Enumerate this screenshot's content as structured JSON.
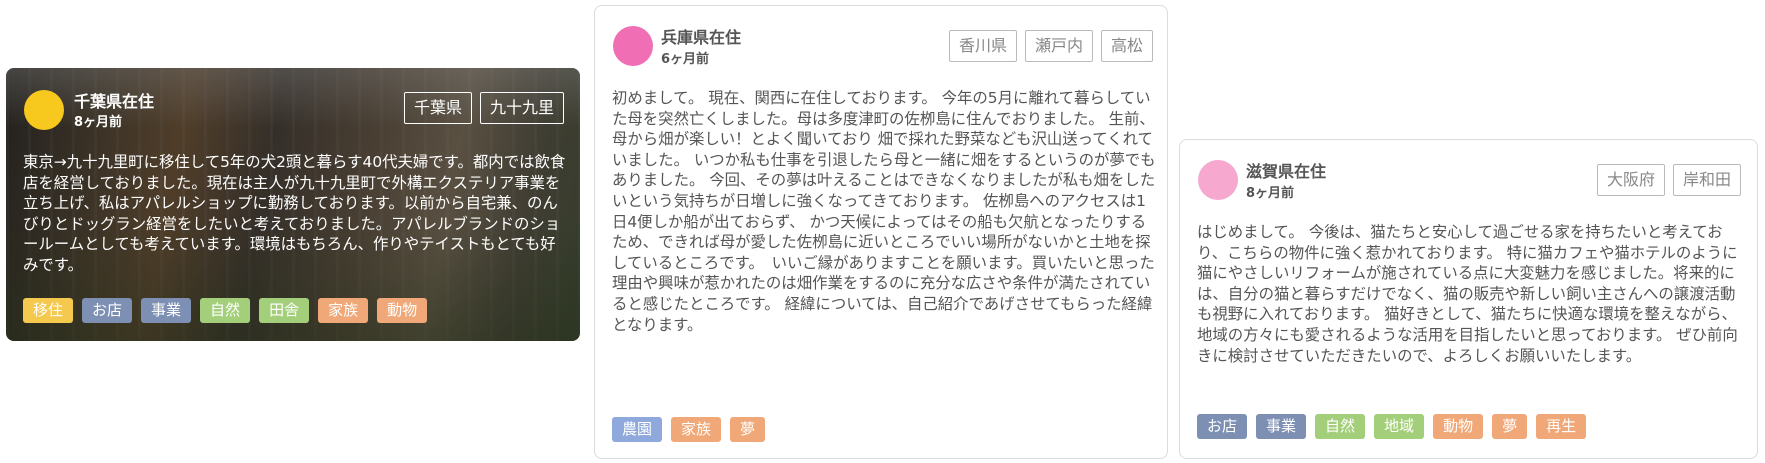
{
  "cards": [
    {
      "avatar_color": "#f7c81e",
      "location": "千葉県在住",
      "time_ago": "8ヶ月前",
      "places": [
        "千葉県",
        "九十九里"
      ],
      "text": "東京→九十九里町に移住して5年の犬2頭と暮らす40代夫婦です。都内では飲食店を経営しておりました。現在は主人が九十九里町で外構エクステリア事業を立ち上げ、私はアパレルショップに勤務しております。以前から自宅兼、のんびりとドッグラン経営をしたいと考えておりました。アパレルブランドのショールームとしても考えています。環境はもちろん、作りやテイストもとても好みです。",
      "tags": [
        {
          "label": "移住",
          "color": "#f5c84e"
        },
        {
          "label": "お店",
          "color": "#7d8fb3"
        },
        {
          "label": "事業",
          "color": "#7d8fb3"
        },
        {
          "label": "自然",
          "color": "#a3cf7a"
        },
        {
          "label": "田舎",
          "color": "#a3cf7a"
        },
        {
          "label": "家族",
          "color": "#f1a878"
        },
        {
          "label": "動物",
          "color": "#f1a878"
        }
      ]
    },
    {
      "avatar_color": "#f06fb4",
      "location": "兵庫県在住",
      "time_ago": "6ヶ月前",
      "places": [
        "香川県",
        "瀬戸内",
        "高松"
      ],
      "text": "初めまして。 現在、関西に在住しております。 今年の5月に離れて暮らしていた母を突然亡くしました。母は多度津町の佐栁島に住んでおりました。 生前、母から畑が楽しい！とよく聞いており 畑で採れた野菜なども沢山送ってくれていました。 いつか私も仕事を引退したら母と一緒に畑をするというのが夢でもありました。 今回、その夢は叶えることはできなくなりましたが私も畑をしたいという気持ちが日増しに強くなってきております。 佐栁島へのアクセスは1日4便しか船が出ておらず、 かつ天候によってはその船も欠航となったりするため、できれば母が愛した佐栁島に近いところでいい場所がないかと土地を探しているところです。　いいご縁がありますことを願います。買いたいと思った理由や興味が惹かれたのは畑作業をするのに充分な広さや条件が満たされていると感じたところです。 経緯については、自己紹介であげさせてもらった経緯となります。",
      "tags": [
        {
          "label": "農園",
          "color": "#8fa9dc"
        },
        {
          "label": "家族",
          "color": "#f1a878"
        },
        {
          "label": "夢",
          "color": "#f1a878"
        }
      ]
    },
    {
      "avatar_color": "#f7a8cf",
      "location": "滋賀県在住",
      "time_ago": "8ヶ月前",
      "places": [
        "大阪府",
        "岸和田"
      ],
      "text": "はじめまして。 今後は、猫たちと安心して過ごせる家を持ちたいと考えており、こちらの物件に強く惹かれております。 特に猫カフェや猫ホテルのように猫にやさしいリフォームが施されている点に大変魅力を感じました。将来的には、自分の猫と暮らすだけでなく、猫の販売や新しい飼い主さんへの譲渡活動も視野に入れております。 猫好きとして、猫たちに快適な環境を整えながら、地域の方々にも愛されるような活用を目指したいと思っております。 ぜひ前向きに検討させていただきたいので、よろしくお願いいたします。",
      "tags": [
        {
          "label": "お店",
          "color": "#7d8fb3"
        },
        {
          "label": "事業",
          "color": "#7d8fb3"
        },
        {
          "label": "自然",
          "color": "#a3cf7a"
        },
        {
          "label": "地域",
          "color": "#a3cf7a"
        },
        {
          "label": "動物",
          "color": "#f1a878"
        },
        {
          "label": "夢",
          "color": "#f1a878"
        },
        {
          "label": "再生",
          "color": "#f1a878"
        }
      ]
    }
  ]
}
